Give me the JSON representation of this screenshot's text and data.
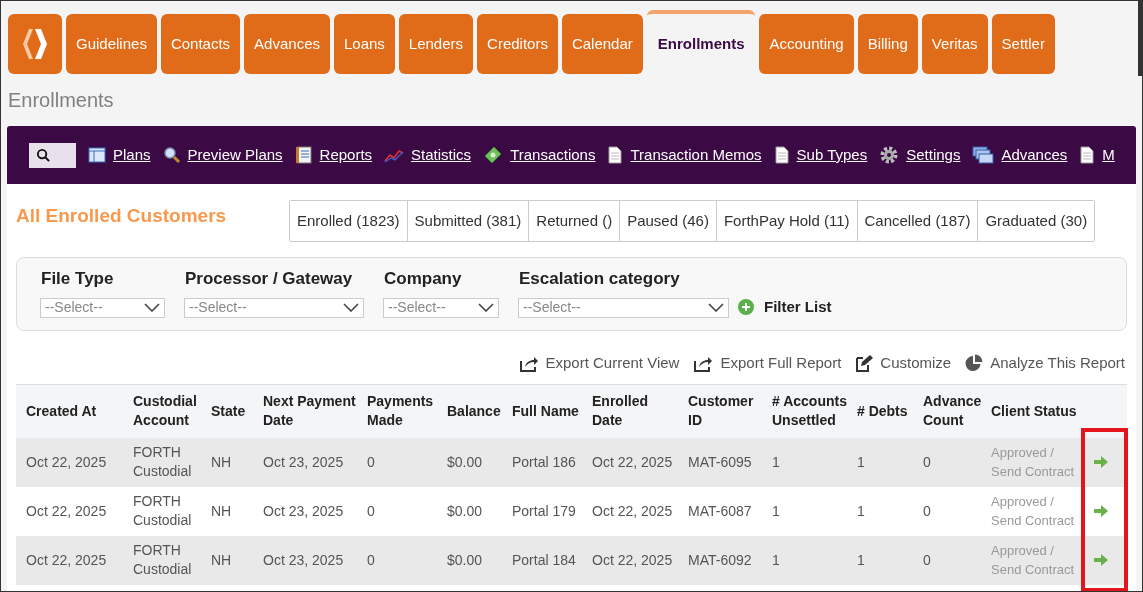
{
  "nav": {
    "tabs": [
      {
        "label": "Guidelines",
        "selected": false
      },
      {
        "label": "Contacts",
        "selected": false
      },
      {
        "label": "Advances",
        "selected": false
      },
      {
        "label": "Loans",
        "selected": false
      },
      {
        "label": "Lenders",
        "selected": false
      },
      {
        "label": "Creditors",
        "selected": false
      },
      {
        "label": "Calendar",
        "selected": false
      },
      {
        "label": "Enrollments",
        "selected": true
      },
      {
        "label": "Accounting",
        "selected": false
      },
      {
        "label": "Billing",
        "selected": false
      },
      {
        "label": "Veritas",
        "selected": false
      },
      {
        "label": "Settler",
        "selected": false
      }
    ]
  },
  "page_title": "Enrollments",
  "toolbar": {
    "links": [
      {
        "label": "Plans"
      },
      {
        "label": "Preview Plans"
      },
      {
        "label": "Reports"
      },
      {
        "label": "Statistics"
      },
      {
        "label": "Transactions"
      },
      {
        "label": "Transaction Memos"
      },
      {
        "label": "Sub Types"
      },
      {
        "label": "Settings"
      },
      {
        "label": "Advances"
      },
      {
        "label": "M"
      }
    ]
  },
  "section_title": "All Enrolled Customers",
  "status_tabs": [
    {
      "label": "Enrolled (1823)"
    },
    {
      "label": "Submitted (381)"
    },
    {
      "label": "Returned ()"
    },
    {
      "label": "Paused (46)"
    },
    {
      "label": "ForthPay Hold (11)"
    },
    {
      "label": "Cancelled (187)"
    },
    {
      "label": "Graduated (30)"
    }
  ],
  "filters": [
    {
      "label": "File Type",
      "value": "--Select--"
    },
    {
      "label": "Processor / Gateway",
      "value": "--Select--"
    },
    {
      "label": "Company",
      "value": "--Select--"
    },
    {
      "label": "Escalation category",
      "value": "--Select--"
    }
  ],
  "filter_button": "Filter List",
  "report_actions": [
    {
      "label": "Export Current View"
    },
    {
      "label": "Export Full Report"
    },
    {
      "label": "Customize"
    },
    {
      "label": "Analyze This Report"
    }
  ],
  "table": {
    "columns": [
      "Created At",
      "Custodial Account",
      "State",
      "Next Payment Date",
      "Payments Made",
      "Balance",
      "Full Name",
      "Enrolled Date",
      "Customer ID",
      "# Accounts Unsettled",
      "# Debts",
      "Advance Count",
      "Client Status"
    ],
    "rows": [
      {
        "cells": [
          "Oct 22, 2025",
          "FORTH Custodial",
          "NH",
          "Oct 23, 2025",
          "0",
          "$0.00",
          "Portal 186",
          "Oct 22, 2025",
          "MAT-6095",
          "1",
          "1",
          "0",
          "Approved / Send Contract"
        ]
      },
      {
        "cells": [
          "Oct 22, 2025",
          "FORTH Custodial",
          "NH",
          "Oct 23, 2025",
          "0",
          "$0.00",
          "Portal 179",
          "Oct 22, 2025",
          "MAT-6087",
          "1",
          "1",
          "0",
          "Approved / Send Contract"
        ]
      },
      {
        "cells": [
          "Oct 22, 2025",
          "FORTH Custodial",
          "NH",
          "Oct 23, 2025",
          "0",
          "$0.00",
          "Portal 184",
          "Oct 22, 2025",
          "MAT-6092",
          "1",
          "1",
          "0",
          "Approved / Send Contract"
        ]
      }
    ]
  }
}
